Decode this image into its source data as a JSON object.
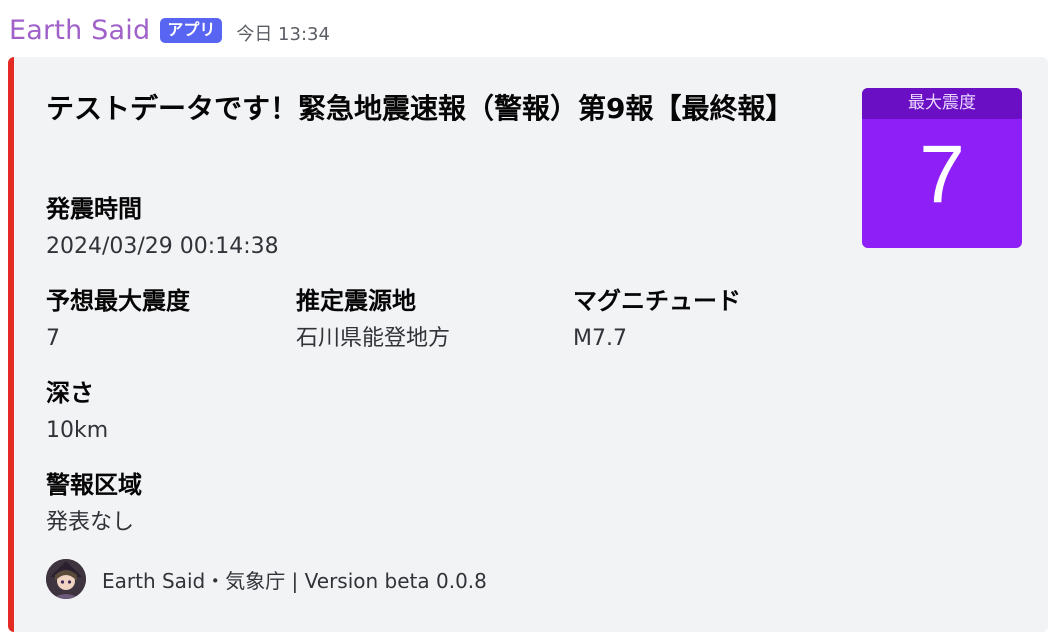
{
  "message": {
    "username": "Earth Said",
    "badge": "アプリ",
    "timestamp": "今日 13:34"
  },
  "embed": {
    "accent_color": "#e32b24",
    "title": "テストデータです！緊急地震速報（警報）第9報【最終報】",
    "fields": {
      "time": {
        "name": "発震時間",
        "value": "2024/03/29 00:14:38"
      },
      "max_intensity": {
        "name": "予想最大震度",
        "value": "7"
      },
      "epicenter": {
        "name": "推定震源地",
        "value": "石川県能登地方"
      },
      "magnitude": {
        "name": "マグニチュード",
        "value": "M7.7"
      },
      "depth": {
        "name": "深さ",
        "value": "10km"
      },
      "warning_area": {
        "name": "警報区域",
        "value": "発表なし"
      }
    },
    "thumbnail": {
      "label": "最大震度",
      "value": "7",
      "color": "#8e1ff7"
    },
    "footer": {
      "text": "Earth Said・気象庁 | Version beta 0.0.8"
    }
  }
}
